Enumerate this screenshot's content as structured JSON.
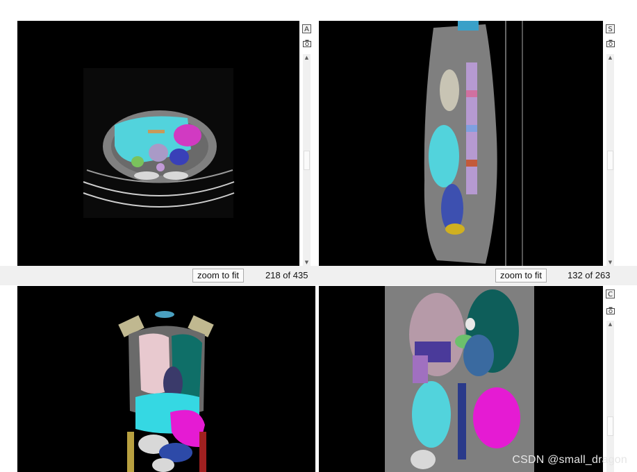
{
  "axial_panel": {
    "orientation_label": "A",
    "zoom_label": "zoom to fit",
    "slice_counter": "218 of 435"
  },
  "sagittal_panel": {
    "orientation_label": "S",
    "zoom_label": "zoom to fit",
    "slice_counter": "132 of 263"
  },
  "coronal_panel": {
    "orientation_label": "C"
  },
  "icons": {
    "camera": "camera-icon",
    "scroll_up": "scroll-up-arrow-icon",
    "scroll_down": "scroll-down-arrow-icon"
  },
  "watermark": "CSDN @small_dragon"
}
